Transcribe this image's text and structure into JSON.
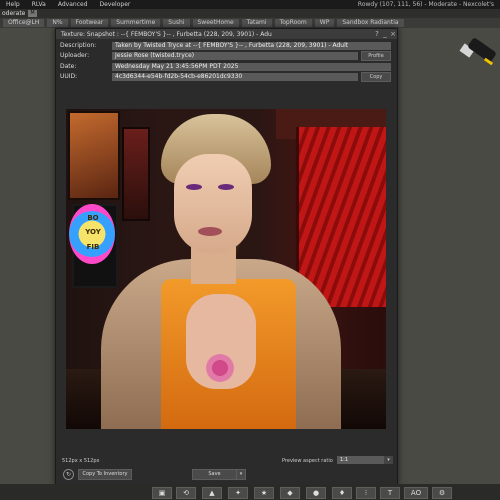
{
  "menubar": {
    "items": [
      "Help",
      "RLVa",
      "Advanced",
      "Developer"
    ],
    "status": "Rowdy (107, 111, 56) - Moderate - Nexcolet's"
  },
  "modbar": {
    "label": "oderate",
    "badge": "M"
  },
  "favorites": [
    "Office@LH",
    "N%",
    "Footwear",
    "Summertime",
    "Sushi",
    "SweetHome",
    "Tatami",
    "TopRoom",
    "WP",
    "Sandbox Radiantia"
  ],
  "window": {
    "title": "Texture: Snapshot : --{ FEMBOY'S }-- , Furbetta (228, 209, 3901) - Adu",
    "controls": [
      "?",
      "_",
      "×"
    ],
    "fields": {
      "description_label": "Description:",
      "description_value": "Taken by Twisted Tryce at --{ FEMBOY'S }-- , Furbetta (228, 209, 3901) - Adult",
      "uploader_label": "Uploader:",
      "uploader_value": "Jessie Rose (twisted.tryce)",
      "profile_button": "Profile",
      "date_label": "Date:",
      "date_value": "Wednesday May 21 3:45:56PM PDT 2025",
      "uuid_label": "UUID:",
      "uuid_value": "4c3d6344-e54b-fd2b-54cb-e86201dc9330",
      "copy_button": "Copy"
    },
    "poster_text": [
      "BO",
      "YOY",
      "FIB"
    ],
    "footer": {
      "dimensions": "512px x 512px",
      "aspect_label": "Preview aspect ratio",
      "aspect_value": "1:1",
      "copy_inventory": "Copy To Inventory",
      "save_button": "Save"
    }
  },
  "bottom_toolbar": [
    "▣",
    "⟲",
    "▲",
    "✦",
    "★",
    "◆",
    "●",
    "♦",
    "⁝",
    "T",
    "AO",
    "⚙"
  ],
  "icons": {
    "refresh": "↻",
    "dropdown": "▾"
  }
}
